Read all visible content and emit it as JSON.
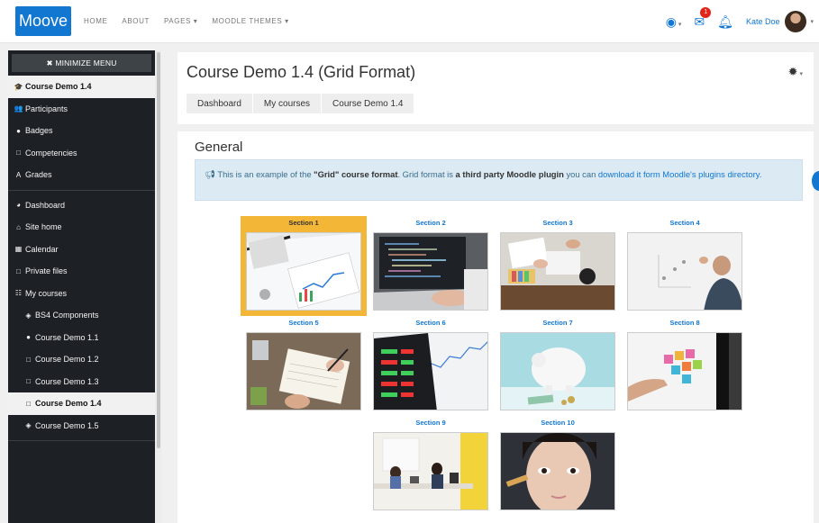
{
  "navbar": {
    "brand": "Moove",
    "links": [
      "HOME",
      "ABOUT",
      "PAGES ▾",
      "MOODLE THEMES ▾"
    ],
    "notification_count": "1",
    "username": "Kate Doe",
    "icons": [
      "globe-icon",
      "envelope-icon",
      "bell-icon"
    ]
  },
  "sidebar": {
    "minimize_label": "✖ MINIMIZE MENU",
    "items": [
      {
        "label": "Course Demo 1.4",
        "icon": "🎓"
      },
      {
        "label": "Participants",
        "icon": "👥"
      },
      {
        "label": "Badges",
        "icon": "●"
      },
      {
        "label": "Competencies",
        "icon": "□"
      },
      {
        "label": "Grades",
        "icon": "A"
      },
      {
        "label": "Dashboard",
        "icon": "◕"
      },
      {
        "label": "Site home",
        "icon": "⌂"
      },
      {
        "label": "Calendar",
        "icon": "▦"
      },
      {
        "label": "Private files",
        "icon": "□"
      },
      {
        "label": "My courses",
        "icon": "☷"
      },
      {
        "label": "BS4 Components",
        "icon": "◈"
      },
      {
        "label": "Course Demo 1.1",
        "icon": "●"
      },
      {
        "label": "Course Demo 1.2",
        "icon": "□"
      },
      {
        "label": "Course Demo 1.3",
        "icon": "□"
      },
      {
        "label": "Course Demo 1.4",
        "icon": "□"
      },
      {
        "label": "Course Demo 1.5",
        "icon": "◈"
      }
    ]
  },
  "header": {
    "title": "Course Demo 1.4 (Grid Format)",
    "breadcrumbs": [
      "Dashboard",
      "My courses",
      "Course Demo 1.4"
    ]
  },
  "main": {
    "section_title": "General",
    "info": {
      "t1": "This is an example of the ",
      "t2": "\"Grid\" course format",
      "t3": ". Grid format is ",
      "t4": "a third party Moodle plugin",
      "t5": " you can ",
      "t6": "download it form Moodle's plugins directory",
      "t7": "."
    },
    "sections": [
      "Section 1",
      "Section 2",
      "Section 3",
      "Section 4",
      "Section 5",
      "Section 6",
      "Section 7",
      "Section 8",
      "Section 9",
      "Section 10"
    ]
  },
  "colors": {
    "brand": "#1177d1",
    "selected_tile": "#f4b636",
    "info_bg": "#dbeaf3"
  }
}
